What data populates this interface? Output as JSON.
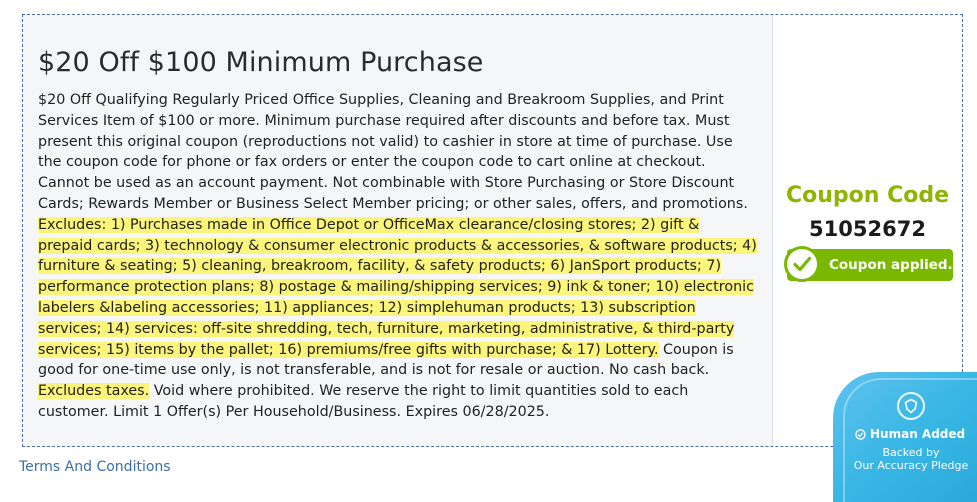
{
  "coupon": {
    "title": "$20 Off $100 Minimum Purchase",
    "desc_part1": "$20 Off Qualifying Regularly Priced Office Supplies, Cleaning and Breakroom Supplies, and Print Services Item of $100 or more. Minimum purchase required after discounts and before tax. Must present this original coupon (reproductions not valid) to cashier in store at time of purchase. Use the coupon code for phone or fax orders or enter the coupon code to cart online at checkout. Cannot be used as an account payment. Not combinable with Store Purchasing or Store Discount Cards; Rewards Member or Business Select Member pricing; or other sales, offers, and promotions. ",
    "desc_highlight1": "Excludes: 1) Purchases made in Office Depot or OfficeMax clearance/closing stores; 2) gift & prepaid cards; 3) technology & consumer electronic products & accessories, & software products; 4) furniture & seating; 5) cleaning, breakroom, facility, & safety products; 6) JanSport products; 7) performance protection plans; 8) postage & mailing/shipping services; 9) ink & toner; 10) electronic labelers &labeling accessories; 11) appliances; 12) simplehuman products; 13) subscription services; 14) services: off-site shredding, tech, furniture, marketing, administrative, & third-party services; 15) items by the pallet; 16) premiums/free gifts with purchase; & 17) Lottery.",
    "desc_part2": " Coupon is good for one-time use only, is not transferable, and is not for resale or auction. No cash back. ",
    "desc_highlight2": "Excludes taxes.",
    "desc_part3": " Void where prohibited. We reserve the right to limit quantities sold to each customer. Limit 1 Offer(s) Per Household/Business. Expires 06/28/2025.",
    "code_label": "Coupon Code",
    "code_value": "51052672",
    "applied_label": "Coupon applied.",
    "check_icon": "checkmark-icon"
  },
  "links": {
    "terms": "Terms And Conditions"
  },
  "badge": {
    "human_added": "Human Added",
    "backed_line1": "Backed by",
    "backed_line2": "Our Accuracy Pledge",
    "icon": "shield-icon"
  },
  "colors": {
    "accent_green": "#7ab800",
    "code_label_green": "#8cb400",
    "highlight": "#fbf57c",
    "link_blue": "#3a6ea5",
    "badge_blue": "#38b6e4"
  }
}
